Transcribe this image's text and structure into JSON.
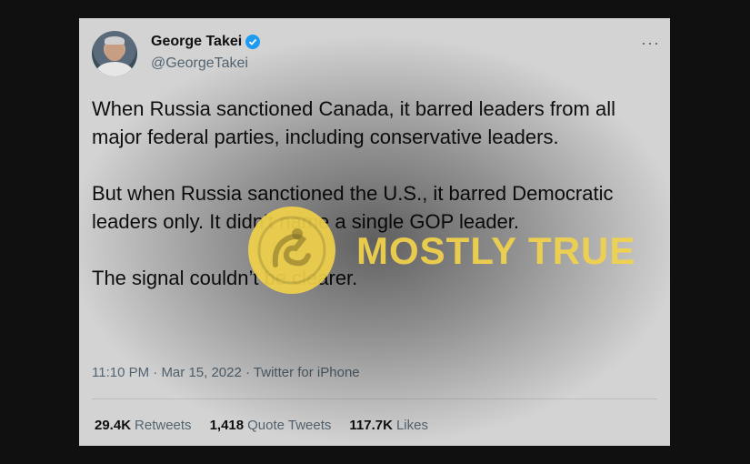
{
  "tweet": {
    "display_name": "George Takei",
    "handle": "@GeorgeTakei",
    "text": "When Russia sanctioned Canada, it barred leaders from all major federal parties, including conservative leaders.\n\nBut when Russia sanctioned the U.S., it barred Democratic leaders only. It didn’t name a single GOP leader.\n\nThe signal couldn’t be clearer.",
    "time": "11:10 PM",
    "date": "Mar 15, 2022",
    "source": "Twitter for iPhone",
    "separator": "·",
    "more_icon": "···",
    "stats": [
      {
        "count": "29.4K",
        "label": "Retweets"
      },
      {
        "count": "1,418",
        "label": "Quote Tweets"
      },
      {
        "count": "117.7K",
        "label": "Likes"
      }
    ]
  },
  "overlay": {
    "verdict": "MOSTLY TRUE",
    "badge_icon": "truth-o-meter-logo",
    "badge_color": "#f0d14a"
  },
  "colors": {
    "background": "#101010",
    "card": "#d3d3d3",
    "verified": "#1d9bf0"
  }
}
